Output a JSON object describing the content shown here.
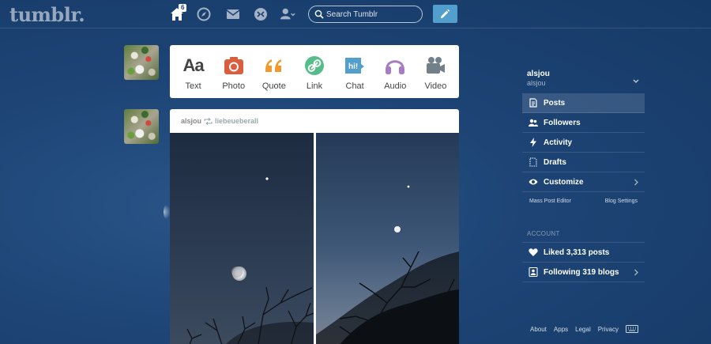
{
  "app": {
    "logo": "tumblr."
  },
  "header": {
    "home_badge": "6",
    "search_placeholder": "Search Tumblr"
  },
  "post_types": [
    {
      "label": "Text",
      "icon": "text-icon",
      "color": "#444444"
    },
    {
      "label": "Photo",
      "icon": "camera-icon",
      "color": "#d95e40"
    },
    {
      "label": "Quote",
      "icon": "quote-icon",
      "color": "#f2992e"
    },
    {
      "label": "Link",
      "icon": "link-icon",
      "color": "#56bc8a"
    },
    {
      "label": "Chat",
      "icon": "chat-icon",
      "color": "#529ecc"
    },
    {
      "label": "Audio",
      "icon": "headphones-icon",
      "color": "#a77dc2"
    },
    {
      "label": "Video",
      "icon": "video-camera-icon",
      "color": "#748089"
    }
  ],
  "post": {
    "author": "alsjou",
    "reblogged_from": "liebeueberall"
  },
  "sidebar": {
    "blog_name": "alsjou",
    "blog_subtitle": "alsjou",
    "items": [
      {
        "label": "Posts",
        "icon": "document-icon"
      },
      {
        "label": "Followers",
        "icon": "people-icon"
      },
      {
        "label": "Activity",
        "icon": "lightning-icon"
      },
      {
        "label": "Drafts",
        "icon": "draft-icon"
      },
      {
        "label": "Customize",
        "icon": "eye-icon"
      }
    ],
    "mass_post_editor": "Mass Post Editor",
    "blog_settings": "Blog Settings",
    "account_heading": "ACCOUNT",
    "account_items": [
      {
        "label": "Liked 3,313 posts",
        "icon": "heart-icon"
      },
      {
        "label": "Following 319 blogs",
        "icon": "add-person-icon"
      }
    ]
  },
  "footer": {
    "links": [
      "About",
      "Apps",
      "Legal",
      "Privacy"
    ]
  },
  "colors": {
    "accent": "#529ecc",
    "background": "#1d4475"
  }
}
